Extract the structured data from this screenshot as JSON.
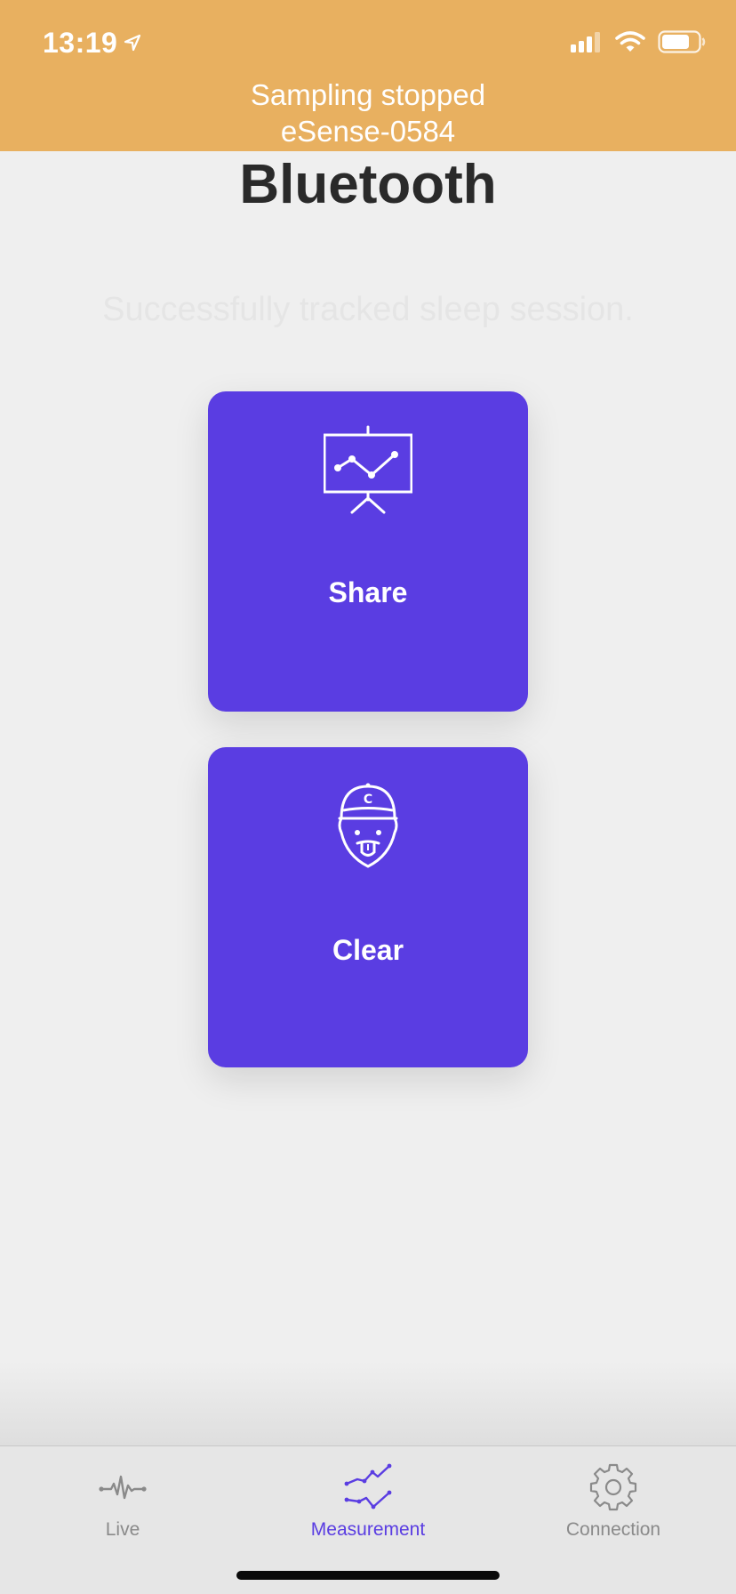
{
  "status_bar": {
    "time": "13:19",
    "location_icon": "location-arrow-icon",
    "signal_icon": "cellular-signal-icon",
    "wifi_icon": "wifi-icon",
    "battery_icon": "battery-icon"
  },
  "banner": {
    "line1": "Sampling stopped",
    "line2": "eSense-0584",
    "color": "#e8b060"
  },
  "page": {
    "title": "Bluetooth",
    "message": "Successfully tracked sleep session."
  },
  "actions": [
    {
      "label": "Share",
      "icon": "presentation-chart-icon"
    },
    {
      "label": "Clear",
      "icon": "cap-face-icon"
    }
  ],
  "tabs": [
    {
      "label": "Live",
      "icon": "pulse-icon",
      "active": false
    },
    {
      "label": "Measurement",
      "icon": "line-chart-icon",
      "active": true
    },
    {
      "label": "Connection",
      "icon": "gear-icon",
      "active": false
    }
  ],
  "colors": {
    "accent": "#5a3de2",
    "background": "#efefef",
    "inactive_tab": "#8a8a8a"
  }
}
